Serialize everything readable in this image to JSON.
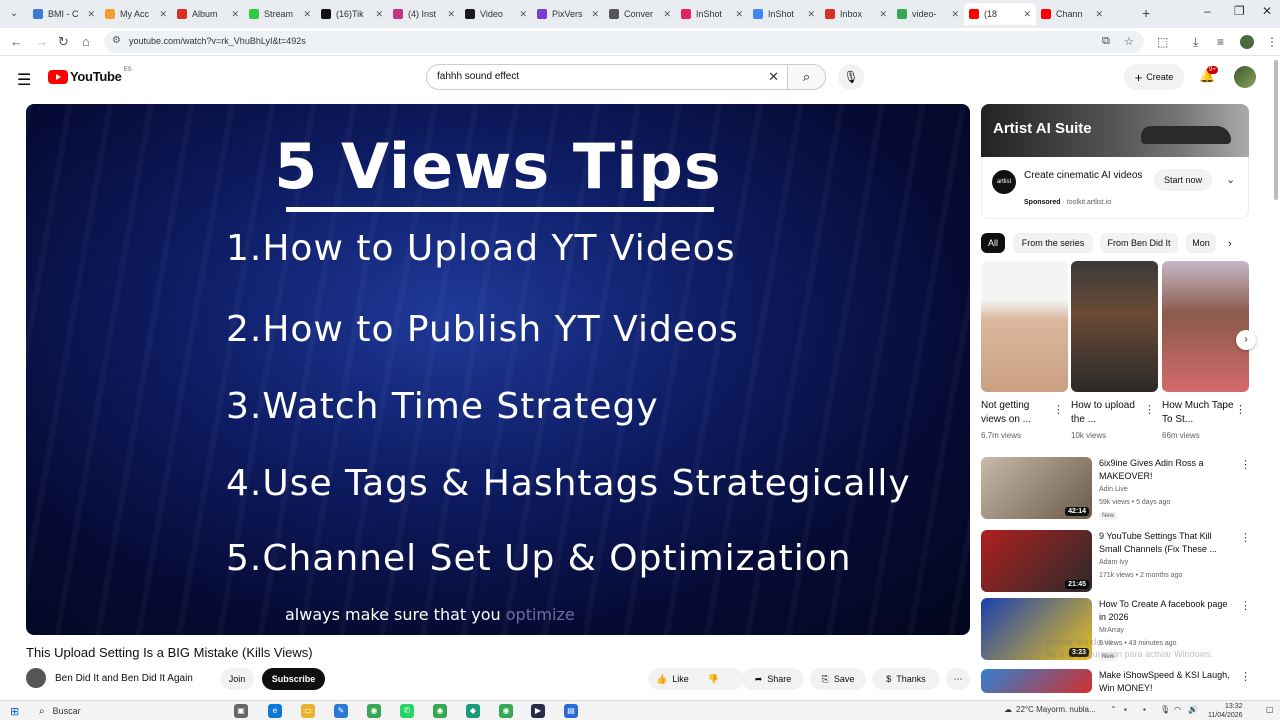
{
  "browser": {
    "tabs": [
      {
        "title": "BMI - C",
        "color": "#3b7bd6"
      },
      {
        "title": "My Acc",
        "color": "#f0a030"
      },
      {
        "title": "Album",
        "color": "#d93025"
      },
      {
        "title": "Stream",
        "color": "#2ecc40"
      },
      {
        "title": "(16)Tik",
        "color": "#111111"
      },
      {
        "title": "(4) Inst",
        "color": "#c13584"
      },
      {
        "title": "Video",
        "color": "#1a1a1a"
      },
      {
        "title": "PixVers",
        "color": "#7a3cd6"
      },
      {
        "title": "Conver",
        "color": "#555555"
      },
      {
        "title": "InShot",
        "color": "#e0245e"
      },
      {
        "title": "InShot",
        "color": "#4285f4"
      },
      {
        "title": "Inbox",
        "color": "#d93025"
      },
      {
        "title": "video-",
        "color": "#34a853"
      },
      {
        "title": "(18",
        "color": "#ff0000"
      },
      {
        "title": "Chann",
        "color": "#ff0000"
      }
    ],
    "url": "youtube.com/watch?v=rk_VhuBhLyI&t=492s"
  },
  "yt": {
    "logo_text": "YouTube",
    "country": "ES",
    "search_query": "fahhh sound effect",
    "create_label": "Create",
    "notif_count": "9+"
  },
  "video": {
    "heading": "5 Views Tips",
    "lines": [
      "1.How to Upload YT Videos",
      "2.How to Publish YT Videos",
      "3.Watch Time Strategy",
      "4.Use Tags & Hashtags Strategically",
      "5.Channel Set Up & Optimization"
    ],
    "caption_main": "always make sure that you ",
    "caption_dim": "optimize",
    "title": "This Upload Setting Is a BIG Mistake (Kills Views)",
    "channel": "Ben Did It and Ben Did It Again",
    "join_label": "Join",
    "subscribe_label": "Subscribe",
    "actions": {
      "like": "Like",
      "share": "Share",
      "save": "Save",
      "thanks": "Thanks"
    }
  },
  "ad": {
    "banner_title": "Artist AI Suite",
    "logo_text": "artlist",
    "text": "Create cinematic AI videos",
    "sponsored": "Sponsored",
    "domain": "toolkit.artlist.io",
    "cta": "Start now"
  },
  "chips": [
    "All",
    "From the series",
    "From Ben Did It",
    "Mon"
  ],
  "shorts": [
    {
      "title": "Not getting views on ...",
      "views": "6.7m views"
    },
    {
      "title": "How to upload the ...",
      "views": "10k views"
    },
    {
      "title": "How Much Tape To St...",
      "views": "66m views"
    }
  ],
  "recs": [
    {
      "title": "6ix9ine Gives Adin Ross a MAKEOVER!",
      "channel": "Adin Live",
      "meta": "59k views • 5 days ago",
      "badge": "New",
      "duration": "42:14",
      "colors": [
        "#c9b9a8",
        "#6a5a4a"
      ]
    },
    {
      "title": "9 YouTube Settings That Kill Small Channels (Fix These ...",
      "channel": "Adam Ivy",
      "meta": "171k views • 2 months ago",
      "badge": "",
      "duration": "21:45",
      "colors": [
        "#b02020",
        "#2a2a2a"
      ]
    },
    {
      "title": "How To Create A facebook page in 2026",
      "channel": "MrArray",
      "meta": "6 views • 43 minutes ago",
      "badge": "New",
      "duration": "3:23",
      "colors": [
        "#1a3fb0",
        "#e8c020"
      ]
    },
    {
      "title": "Make iShowSpeed & KSI Laugh, Win MONEY!",
      "channel": "",
      "meta": "",
      "badge": "",
      "duration": "",
      "colors": [
        "#3080d0",
        "#d03030"
      ]
    }
  ],
  "watermark": [
    "Activar Windows",
    "Ve a Configuración para activar Windows."
  ],
  "taskbar": {
    "search": "Buscar",
    "weather": "22°C  Mayorm. nubla...",
    "time": "13:32",
    "date": "11/04/2026"
  }
}
